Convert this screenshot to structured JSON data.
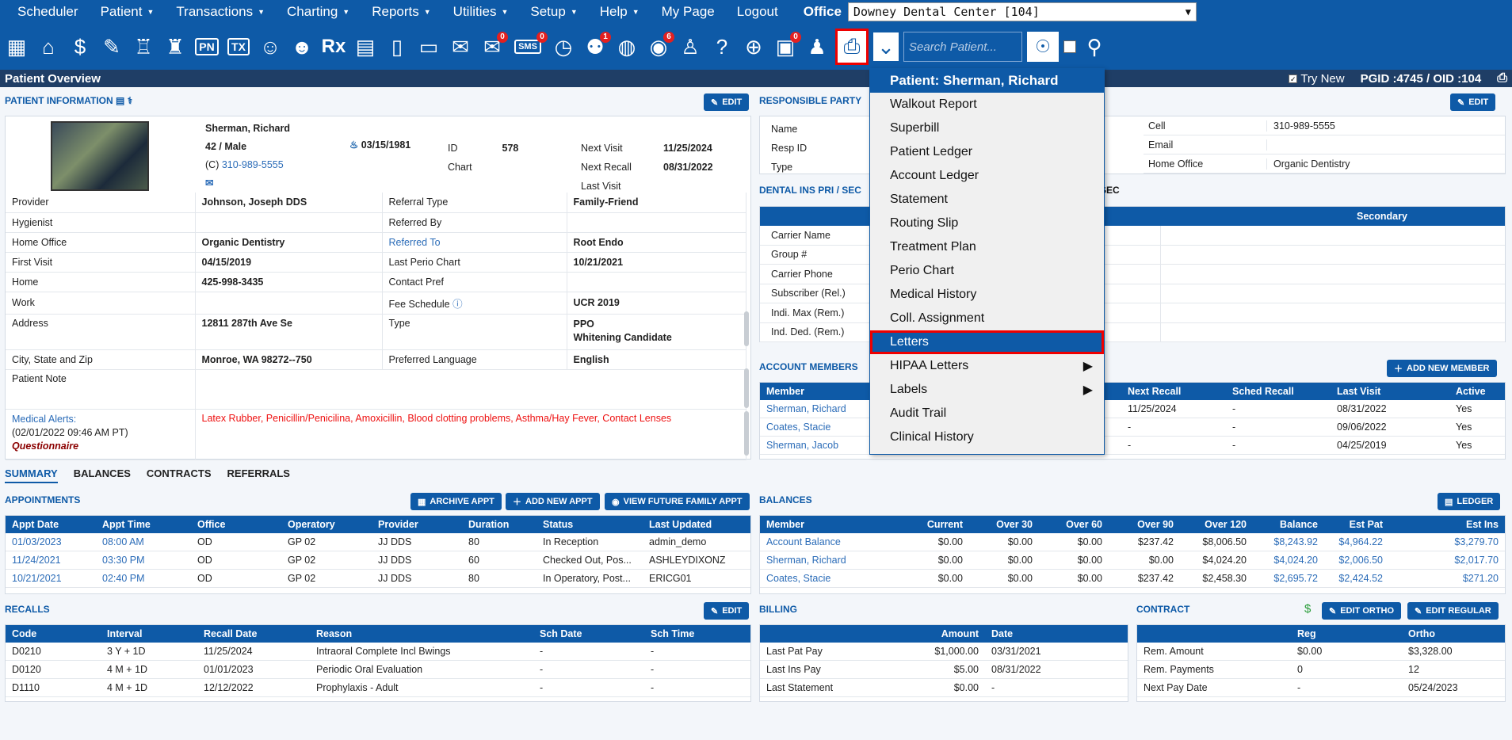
{
  "menu": {
    "items": [
      {
        "label": "Scheduler",
        "caret": false
      },
      {
        "label": "Patient",
        "caret": true
      },
      {
        "label": "Transactions",
        "caret": true
      },
      {
        "label": "Charting",
        "caret": true
      },
      {
        "label": "Reports",
        "caret": true
      },
      {
        "label": "Utilities",
        "caret": true
      },
      {
        "label": "Setup",
        "caret": true
      },
      {
        "label": "Help",
        "caret": true
      },
      {
        "label": "My Page",
        "caret": false
      },
      {
        "label": "Logout",
        "caret": false
      }
    ],
    "office_label": "Office",
    "office_value": "Downey Dental Center [104]"
  },
  "toolbar": {
    "badges": {
      "messages": "0",
      "sms": "0",
      "alerts": "1",
      "online": "6",
      "labs": "0"
    },
    "text_icons": {
      "pn": "PN",
      "tx": "TX",
      "rx": "Rx",
      "sms": "SMS"
    },
    "search_placeholder": "Search Patient..."
  },
  "titlebar": {
    "title": "Patient Overview",
    "try_new": "Try New",
    "ids": "PGID :4745 / OID :104"
  },
  "patient_info": {
    "title": "PATIENT INFORMATION",
    "edit": "EDIT",
    "name": "Sherman, Richard",
    "age_sex": "42 / Male",
    "phone_prefix": "(C)",
    "phone": "310-989-5555",
    "dob": "03/15/1981",
    "id_label": "ID",
    "id": "578",
    "chart_label": "Chart",
    "next_visit_label": "Next Visit",
    "next_visit": "",
    "next_recall_label": "Next Recall",
    "next_recall": "11/25/2024",
    "last_visit_label": "Last Visit",
    "last_visit": "08/31/2022",
    "rows": [
      [
        "Provider",
        "Johnson, Joseph DDS",
        "Referral Type",
        "Family-Friend"
      ],
      [
        "Hygienist",
        "",
        "Referred By",
        ""
      ],
      [
        "Home Office",
        "Organic Dentistry",
        "Referred To",
        "Root Endo"
      ],
      [
        "First Visit",
        "04/15/2019",
        "Last Perio Chart",
        "10/21/2021"
      ],
      [
        "Home",
        "425-998-3435",
        "Contact Pref",
        ""
      ],
      [
        "Work",
        "",
        "Fee Schedule",
        "UCR 2019"
      ]
    ],
    "address_label": "Address",
    "address": "12811 287th Ave Se",
    "type_label": "Type",
    "type1": "PPO",
    "type2": "Whitening Candidate",
    "city_label": "City, State and Zip",
    "city": "Monroe, WA 98272--750",
    "lang_label": "Preferred Language",
    "lang": "English",
    "note_label": "Patient Note",
    "alerts_label": "Medical Alerts:",
    "alerts_date": "(02/01/2022 09:46 AM PT)",
    "questionnaire": "Questionnaire",
    "alerts": "Latex Rubber, Penicillin/Penicilina, Amoxicillin, Blood clotting problems, Asthma/Hay Fever, Contact Lenses"
  },
  "responsible": {
    "title": "RESPONSIBLE PARTY",
    "edit": "EDIT",
    "left_labels": [
      "Name",
      "Resp ID",
      "Type"
    ],
    "right": [
      [
        "Cell",
        "310-989-5555"
      ],
      [
        "Email",
        ""
      ],
      [
        "Home Office",
        "Organic Dentistry"
      ]
    ]
  },
  "dental_ins": {
    "title": "DENTAL INS PRI / SEC",
    "sec_tail": "SEC",
    "secondary": "Secondary",
    "labels": [
      "Carrier Name",
      "Group #",
      "Carrier Phone",
      "Subscriber (Rel.)",
      "Indi. Max (Rem.)",
      "Ind. Ded. (Rem.)"
    ]
  },
  "account_members": {
    "title": "ACCOUNT MEMBERS",
    "add": "ADD NEW MEMBER",
    "headers": [
      "Member",
      "Next Recall",
      "Sched Recall",
      "Last Visit",
      "Active"
    ],
    "rows": [
      [
        "Sherman, Richard",
        "11/25/2024",
        "-",
        "08/31/2022",
        "Yes"
      ],
      [
        "Coates, Stacie",
        "-",
        "-",
        "09/06/2022",
        "Yes"
      ],
      [
        "Sherman, Jacob",
        "-",
        "-",
        "04/25/2019",
        "Yes"
      ]
    ]
  },
  "tabs": [
    "SUMMARY",
    "BALANCES",
    "CONTRACTS",
    "REFERRALS"
  ],
  "appointments": {
    "title": "APPOINTMENTS",
    "archive": "ARCHIVE APPT",
    "add": "ADD NEW APPT",
    "view": "VIEW FUTURE FAMILY APPT",
    "headers": [
      "Appt Date",
      "Appt Time",
      "Office",
      "Operatory",
      "Provider",
      "Duration",
      "Status",
      "Last Updated"
    ],
    "rows": [
      [
        "01/03/2023",
        "08:00 AM",
        "OD",
        "GP 02",
        "JJ DDS",
        "80",
        "In Reception",
        "admin_demo"
      ],
      [
        "11/24/2021",
        "03:30 PM",
        "OD",
        "GP 02",
        "JJ DDS",
        "60",
        "Checked Out, Pos...",
        "ASHLEYDIXONZ"
      ],
      [
        "10/21/2021",
        "02:40 PM",
        "OD",
        "GP 02",
        "JJ DDS",
        "80",
        "In Operatory, Post...",
        "ERICG01"
      ]
    ]
  },
  "balances": {
    "title": "BALANCES",
    "ledger": "LEDGER",
    "headers": [
      "Member",
      "Current",
      "Over 30",
      "Over 60",
      "Over 90",
      "Over 120",
      "Balance",
      "Est Pat",
      "Est Ins"
    ],
    "rows": [
      [
        "Account Balance",
        "$0.00",
        "$0.00",
        "$0.00",
        "$237.42",
        "$8,006.50",
        "$8,243.92",
        "$4,964.22",
        "$3,279.70"
      ],
      [
        "Sherman, Richard",
        "$0.00",
        "$0.00",
        "$0.00",
        "$0.00",
        "$4,024.20",
        "$4,024.20",
        "$2,006.50",
        "$2,017.70"
      ],
      [
        "Coates, Stacie",
        "$0.00",
        "$0.00",
        "$0.00",
        "$237.42",
        "$2,458.30",
        "$2,695.72",
        "$2,424.52",
        "$271.20"
      ]
    ]
  },
  "recalls": {
    "title": "RECALLS",
    "edit": "EDIT",
    "headers": [
      "Code",
      "Interval",
      "Recall Date",
      "Reason",
      "Sch Date",
      "Sch Time"
    ],
    "rows": [
      [
        "D0210",
        "3 Y + 1D",
        "11/25/2024",
        "Intraoral Complete Incl Bwings",
        "-",
        "-"
      ],
      [
        "D0120",
        "4 M + 1D",
        "01/01/2023",
        "Periodic Oral Evaluation",
        "-",
        "-"
      ],
      [
        "D1110",
        "4 M + 1D",
        "12/12/2022",
        "Prophylaxis - Adult",
        "-",
        "-"
      ]
    ]
  },
  "billing": {
    "title": "BILLING",
    "headers": [
      "",
      "Amount",
      "Date"
    ],
    "rows": [
      [
        "Last Pat Pay",
        "$1,000.00",
        "03/31/2021"
      ],
      [
        "Last Ins Pay",
        "$5.00",
        "08/31/2022"
      ],
      [
        "Last Statement",
        "$0.00",
        "-"
      ]
    ]
  },
  "contract": {
    "title": "CONTRACT",
    "edit_ortho": "EDIT ORTHO",
    "edit_regular": "EDIT REGULAR",
    "headers": [
      "",
      "Reg",
      "Ortho"
    ],
    "rows": [
      [
        "Rem. Amount",
        "$0.00",
        "$3,328.00"
      ],
      [
        "Rem. Payments",
        "0",
        "12"
      ],
      [
        "Next Pay Date",
        "-",
        "05/24/2023"
      ]
    ]
  },
  "print_menu": {
    "header": "Patient: Sherman, Richard",
    "items": [
      {
        "label": "Walkout Report",
        "sub": false
      },
      {
        "label": "Superbill",
        "sub": false
      },
      {
        "label": "Patient Ledger",
        "sub": false
      },
      {
        "label": "Account Ledger",
        "sub": false
      },
      {
        "label": "Statement",
        "sub": false
      },
      {
        "label": "Routing Slip",
        "sub": false
      },
      {
        "label": "Treatment Plan",
        "sub": false
      },
      {
        "label": "Perio Chart",
        "sub": false
      },
      {
        "label": "Medical History",
        "sub": false
      },
      {
        "label": "Coll. Assignment",
        "sub": false
      },
      {
        "label": "Letters",
        "sub": false,
        "selected": true
      },
      {
        "label": "HIPAA Letters",
        "sub": true
      },
      {
        "label": "Labels",
        "sub": true
      },
      {
        "label": "Audit Trail",
        "sub": false
      },
      {
        "label": "Clinical History",
        "sub": false
      }
    ]
  }
}
